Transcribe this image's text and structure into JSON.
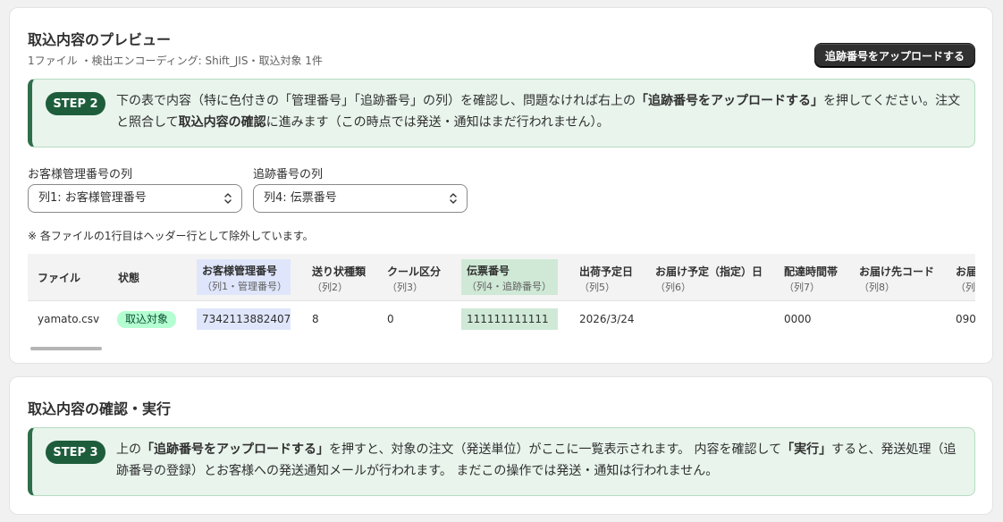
{
  "preview": {
    "title": "取込内容のプレビュー",
    "subtitle": "1ファイル ・検出エンコーディング: Shift_JIS・取込対象 1件",
    "upload_button": "追跡番号をアップロードする",
    "step": {
      "label": "STEP 2",
      "text_1": "下の表で内容（特に色付きの「管理番号」「追跡番号」の列）を確認し、問題なければ右上の",
      "text_bold_1": "「追跡番号をアップロードする」",
      "text_2": "を押してください。注文と照合して",
      "text_bold_2": "取込内容の確認",
      "text_3": "に進みます（この時点では発送・通知はまだ行われません）。"
    },
    "customer_select": {
      "label": "お客様管理番号の列",
      "value": "列1: お客様管理番号"
    },
    "tracking_select": {
      "label": "追跡番号の列",
      "value": "列4: 伝票番号"
    },
    "note": "※ 各ファイルの1行目はヘッダー行として除外しています。",
    "table": {
      "headers": [
        {
          "label": "ファイル",
          "sub": ""
        },
        {
          "label": "状態",
          "sub": ""
        },
        {
          "label": "お客様管理番号",
          "sub": "（列1・管理番号）"
        },
        {
          "label": "送り状種類",
          "sub": "（列2）"
        },
        {
          "label": "クール区分",
          "sub": "（列3）"
        },
        {
          "label": "伝票番号",
          "sub": "（列4・追跡番号）"
        },
        {
          "label": "出荷予定日",
          "sub": "（列5）"
        },
        {
          "label": "お届け予定（指定）日",
          "sub": "（列6）"
        },
        {
          "label": "配達時間帯",
          "sub": "（列7）"
        },
        {
          "label": "お届け先コード",
          "sub": "（列8）"
        },
        {
          "label": "お届",
          "sub": "（列"
        }
      ],
      "row": {
        "file": "yamato.csv",
        "status": "取込対象",
        "customer_no": "7342113882407",
        "slip_type": "8",
        "cool": "0",
        "tracking_no": "111111111111",
        "ship_date": "2026/3/24",
        "delivery_date": "",
        "time_slot": "0000",
        "dest_code": "",
        "extra": "090"
      }
    }
  },
  "confirm": {
    "title": "取込内容の確認・実行",
    "step": {
      "label": "STEP 3",
      "text_1": "上の",
      "text_bold_1": "「追跡番号をアップロードする」",
      "text_2": "を押すと、対象の注文（発送単位）がここに一覧表示されます。 内容を確認して",
      "text_bold_2": "「実行」",
      "text_3": "すると、発送処理（追跡番号の登録）とお客様への発送通知メールが行われます。 まだこの操作では発送・通知は行われません。"
    }
  },
  "colors": {
    "step_pill": "#1e5d3b",
    "step_bg": "#e8f4ec",
    "highlight_blue": "#dfe6fb",
    "highlight_green": "#cfe9d6",
    "badge_bg": "#b4fed2"
  },
  "icons": [
    "select-chevron-icon"
  ]
}
